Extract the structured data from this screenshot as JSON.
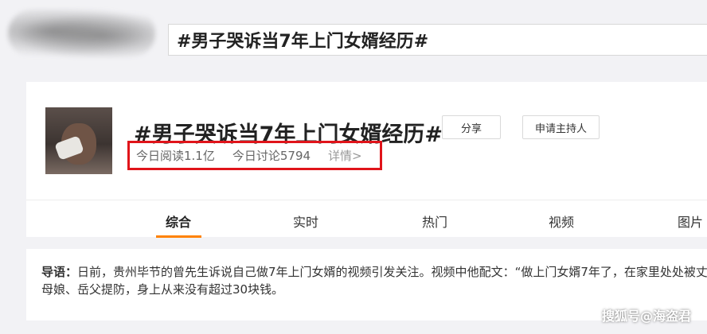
{
  "header": {
    "search_text": "#男子哭诉当7年上门女婿经历#"
  },
  "topic": {
    "title": "#男子哭诉当7年上门女婿经历#",
    "share_label": "分享",
    "apply_host_label": "申请主持人",
    "reads": "今日阅读1.1亿",
    "discussions": "今日讨论5794",
    "details": "详情>",
    "highlight_color": "#e0141a"
  },
  "tabs": [
    {
      "label": "综合",
      "active": true
    },
    {
      "label": "实时",
      "active": false
    },
    {
      "label": "热门",
      "active": false
    },
    {
      "label": "视频",
      "active": false
    },
    {
      "label": "图片",
      "active": false
    }
  ],
  "intro": {
    "lead": "导语：",
    "text": "日前，贵州毕节的曾先生诉说自己做7年上门女婿的视频引发关注。视频中他配文：“做上门女婿7年了，在家里处处被丈母娘、岳父提防，身上从来没有超过30块钱。"
  },
  "watermark": "搜狐号@海盗君",
  "accent_color": "#ff8200"
}
